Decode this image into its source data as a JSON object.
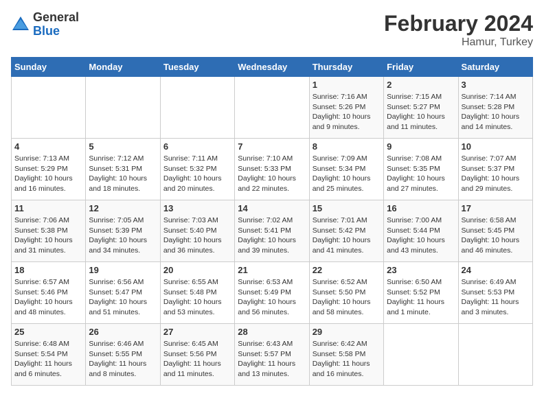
{
  "header": {
    "logo_general": "General",
    "logo_blue": "Blue",
    "title": "February 2024",
    "location": "Hamur, Turkey"
  },
  "days_of_week": [
    "Sunday",
    "Monday",
    "Tuesday",
    "Wednesday",
    "Thursday",
    "Friday",
    "Saturday"
  ],
  "weeks": [
    {
      "days": [
        {
          "num": "",
          "info": ""
        },
        {
          "num": "",
          "info": ""
        },
        {
          "num": "",
          "info": ""
        },
        {
          "num": "",
          "info": ""
        },
        {
          "num": "1",
          "info": "Sunrise: 7:16 AM\nSunset: 5:26 PM\nDaylight: 10 hours\nand 9 minutes."
        },
        {
          "num": "2",
          "info": "Sunrise: 7:15 AM\nSunset: 5:27 PM\nDaylight: 10 hours\nand 11 minutes."
        },
        {
          "num": "3",
          "info": "Sunrise: 7:14 AM\nSunset: 5:28 PM\nDaylight: 10 hours\nand 14 minutes."
        }
      ]
    },
    {
      "days": [
        {
          "num": "4",
          "info": "Sunrise: 7:13 AM\nSunset: 5:29 PM\nDaylight: 10 hours\nand 16 minutes."
        },
        {
          "num": "5",
          "info": "Sunrise: 7:12 AM\nSunset: 5:31 PM\nDaylight: 10 hours\nand 18 minutes."
        },
        {
          "num": "6",
          "info": "Sunrise: 7:11 AM\nSunset: 5:32 PM\nDaylight: 10 hours\nand 20 minutes."
        },
        {
          "num": "7",
          "info": "Sunrise: 7:10 AM\nSunset: 5:33 PM\nDaylight: 10 hours\nand 22 minutes."
        },
        {
          "num": "8",
          "info": "Sunrise: 7:09 AM\nSunset: 5:34 PM\nDaylight: 10 hours\nand 25 minutes."
        },
        {
          "num": "9",
          "info": "Sunrise: 7:08 AM\nSunset: 5:35 PM\nDaylight: 10 hours\nand 27 minutes."
        },
        {
          "num": "10",
          "info": "Sunrise: 7:07 AM\nSunset: 5:37 PM\nDaylight: 10 hours\nand 29 minutes."
        }
      ]
    },
    {
      "days": [
        {
          "num": "11",
          "info": "Sunrise: 7:06 AM\nSunset: 5:38 PM\nDaylight: 10 hours\nand 31 minutes."
        },
        {
          "num": "12",
          "info": "Sunrise: 7:05 AM\nSunset: 5:39 PM\nDaylight: 10 hours\nand 34 minutes."
        },
        {
          "num": "13",
          "info": "Sunrise: 7:03 AM\nSunset: 5:40 PM\nDaylight: 10 hours\nand 36 minutes."
        },
        {
          "num": "14",
          "info": "Sunrise: 7:02 AM\nSunset: 5:41 PM\nDaylight: 10 hours\nand 39 minutes."
        },
        {
          "num": "15",
          "info": "Sunrise: 7:01 AM\nSunset: 5:42 PM\nDaylight: 10 hours\nand 41 minutes."
        },
        {
          "num": "16",
          "info": "Sunrise: 7:00 AM\nSunset: 5:44 PM\nDaylight: 10 hours\nand 43 minutes."
        },
        {
          "num": "17",
          "info": "Sunrise: 6:58 AM\nSunset: 5:45 PM\nDaylight: 10 hours\nand 46 minutes."
        }
      ]
    },
    {
      "days": [
        {
          "num": "18",
          "info": "Sunrise: 6:57 AM\nSunset: 5:46 PM\nDaylight: 10 hours\nand 48 minutes."
        },
        {
          "num": "19",
          "info": "Sunrise: 6:56 AM\nSunset: 5:47 PM\nDaylight: 10 hours\nand 51 minutes."
        },
        {
          "num": "20",
          "info": "Sunrise: 6:55 AM\nSunset: 5:48 PM\nDaylight: 10 hours\nand 53 minutes."
        },
        {
          "num": "21",
          "info": "Sunrise: 6:53 AM\nSunset: 5:49 PM\nDaylight: 10 hours\nand 56 minutes."
        },
        {
          "num": "22",
          "info": "Sunrise: 6:52 AM\nSunset: 5:50 PM\nDaylight: 10 hours\nand 58 minutes."
        },
        {
          "num": "23",
          "info": "Sunrise: 6:50 AM\nSunset: 5:52 PM\nDaylight: 11 hours\nand 1 minute."
        },
        {
          "num": "24",
          "info": "Sunrise: 6:49 AM\nSunset: 5:53 PM\nDaylight: 11 hours\nand 3 minutes."
        }
      ]
    },
    {
      "days": [
        {
          "num": "25",
          "info": "Sunrise: 6:48 AM\nSunset: 5:54 PM\nDaylight: 11 hours\nand 6 minutes."
        },
        {
          "num": "26",
          "info": "Sunrise: 6:46 AM\nSunset: 5:55 PM\nDaylight: 11 hours\nand 8 minutes."
        },
        {
          "num": "27",
          "info": "Sunrise: 6:45 AM\nSunset: 5:56 PM\nDaylight: 11 hours\nand 11 minutes."
        },
        {
          "num": "28",
          "info": "Sunrise: 6:43 AM\nSunset: 5:57 PM\nDaylight: 11 hours\nand 13 minutes."
        },
        {
          "num": "29",
          "info": "Sunrise: 6:42 AM\nSunset: 5:58 PM\nDaylight: 11 hours\nand 16 minutes."
        },
        {
          "num": "",
          "info": ""
        },
        {
          "num": "",
          "info": ""
        }
      ]
    }
  ]
}
